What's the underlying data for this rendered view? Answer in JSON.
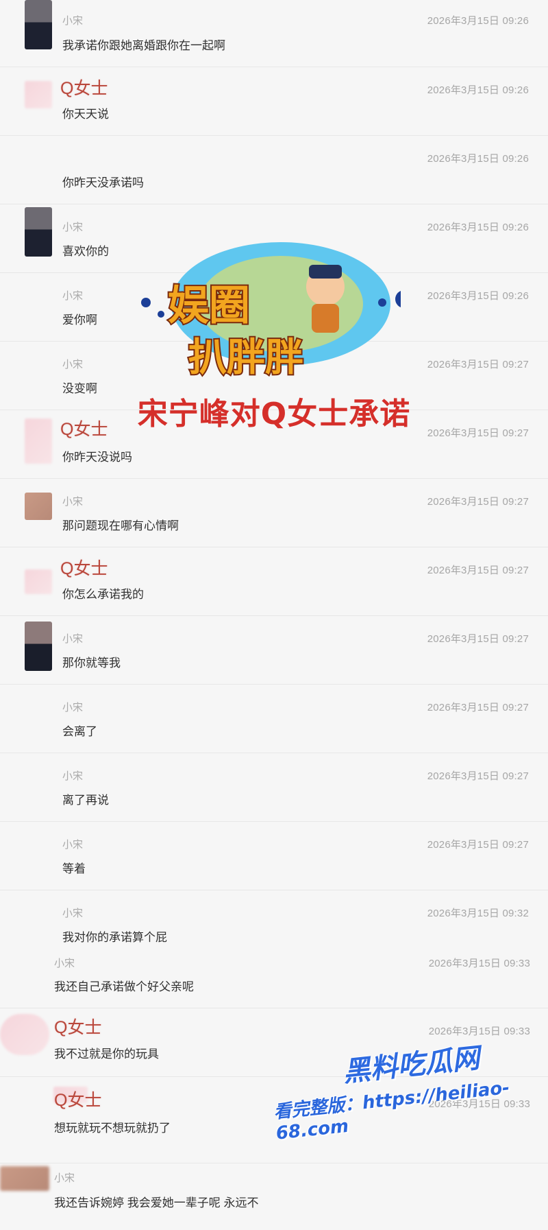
{
  "messages": [
    {
      "sender": "小宋",
      "time": "2026年3月15日 09:26",
      "text": "我承诺你跟她离婚跟你在一起啊"
    },
    {
      "sender": "Q女士",
      "time": "2026年3月15日 09:26",
      "text": "你天天说"
    },
    {
      "sender": "",
      "time": "2026年3月15日 09:26",
      "text": "你昨天没承诺吗"
    },
    {
      "sender": "小宋",
      "time": "2026年3月15日 09:26",
      "text": "喜欢你的"
    },
    {
      "sender": "小宋",
      "time": "2026年3月15日 09:26",
      "text": "爱你啊"
    },
    {
      "sender": "小宋",
      "time": "2026年3月15日 09:27",
      "text": "没变啊"
    },
    {
      "sender": "Q女士",
      "time": "2026年3月15日 09:27",
      "text": "你昨天没说吗"
    },
    {
      "sender": "小宋",
      "time": "2026年3月15日 09:27",
      "text": "那问题现在哪有心情啊"
    },
    {
      "sender": "Q女士",
      "time": "2026年3月15日 09:27",
      "text": "你怎么承诺我的"
    },
    {
      "sender": "小宋",
      "time": "2026年3月15日 09:27",
      "text": "那你就等我"
    },
    {
      "sender": "小宋",
      "time": "2026年3月15日 09:27",
      "text": "会离了"
    },
    {
      "sender": "小宋",
      "time": "2026年3月15日 09:27",
      "text": "离了再说"
    },
    {
      "sender": "小宋",
      "time": "2026年3月15日 09:27",
      "text": "等着"
    },
    {
      "sender": "小宋",
      "time": "2026年3月15日 09:32",
      "text": "我对你的承诺算个屁"
    },
    {
      "sender": "小宋",
      "time": "2026年3月15日 09:33",
      "text": "我还自己承诺做个好父亲呢"
    },
    {
      "sender": "Q女士",
      "time": "2026年3月15日 09:33",
      "text": "我不过就是你的玩具"
    },
    {
      "sender": "Q女士",
      "time": "2026年3月15日 09:33",
      "text": "想玩就玩不想玩就扔了"
    },
    {
      "sender": "小宋",
      "time": "",
      "text": "我还告诉婉婷 我会爱她一辈子呢 永远不"
    }
  ],
  "overlay": {
    "logo_top_text": "娱圈",
    "logo_bottom_text": "扒胖胖",
    "caption": "宋宁峰对Q女士承诺"
  },
  "watermark": {
    "site": "黑料吃瓜网",
    "url": "看完整版：https://heiliao-68.com"
  },
  "colors": {
    "background": "#f6f6f6",
    "sender_q": "#b9473b",
    "caption_red": "#d52f2a",
    "watermark_blue": "#2d6ae0"
  }
}
